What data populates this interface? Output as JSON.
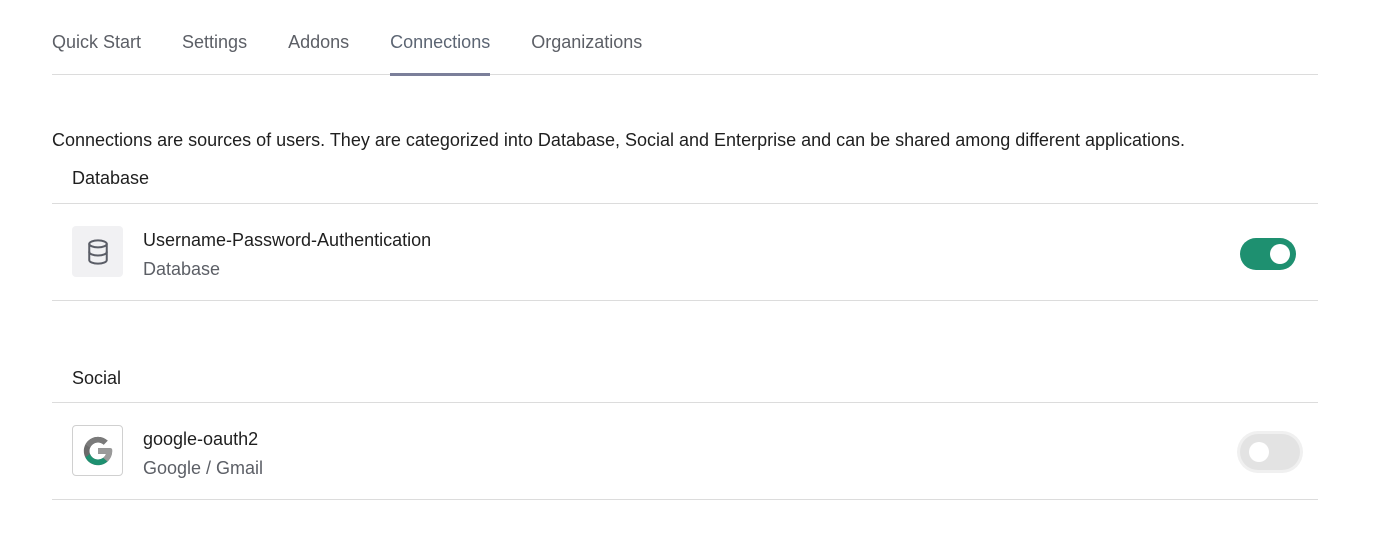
{
  "tabs": [
    {
      "label": "Quick Start",
      "active": false
    },
    {
      "label": "Settings",
      "active": false
    },
    {
      "label": "Addons",
      "active": false
    },
    {
      "label": "Connections",
      "active": true
    },
    {
      "label": "Organizations",
      "active": false
    }
  ],
  "intro": "Connections are sources of users. They are categorized into Database, Social and Enterprise and can be shared among different applications.",
  "sections": [
    {
      "title": "Database",
      "connection": {
        "name": "Username-Password-Authentication",
        "type": "Database",
        "icon": "database-icon",
        "enabled": true
      }
    },
    {
      "title": "Social",
      "connection": {
        "name": "google-oauth2",
        "type": "Google / Gmail",
        "icon": "google-icon",
        "enabled": false
      }
    }
  ],
  "colors": {
    "toggle_on": "#1e9070",
    "toggle_off": "#e3e3e3",
    "active_tab_underline": "#7b7f9a"
  }
}
